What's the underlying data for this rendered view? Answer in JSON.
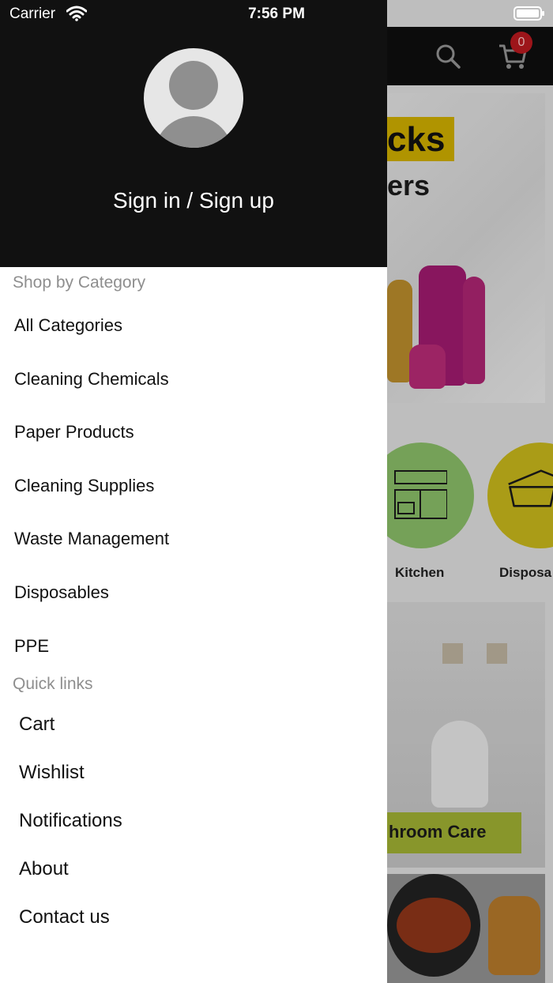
{
  "status_bar": {
    "carrier": "Carrier",
    "time": "7:56 PM"
  },
  "background": {
    "cart_count": "0",
    "banner_heading": "cks",
    "banner_sub": "ers",
    "circles": [
      {
        "label": "Kitchen",
        "color": "#8cc46a"
      },
      {
        "label": "Disposa",
        "color": "#cdbd1c"
      }
    ],
    "bath_label": "hroom Care"
  },
  "drawer": {
    "sign_in_label": "Sign in / Sign up",
    "shop_by_category_title": "Shop by Category",
    "categories": [
      "All Categories",
      "Cleaning Chemicals",
      "Paper Products",
      "Cleaning Supplies",
      "Waste Management",
      "Disposables",
      "PPE"
    ],
    "quick_links_title": "Quick links",
    "quick_links": [
      "Cart",
      "Wishlist",
      "Notifications",
      "About",
      "Contact us"
    ]
  },
  "colors": {
    "drawer_header": "#111111",
    "muted_text": "#8e8e8e",
    "badge": "#b3191e"
  }
}
